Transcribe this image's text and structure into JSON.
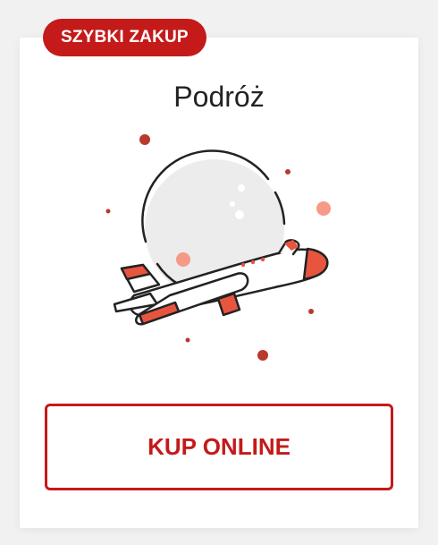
{
  "badge": {
    "label": "SZYBKI ZAKUP"
  },
  "card": {
    "title": "Podróż",
    "illustration_icon": "airplane-moon-icon"
  },
  "cta": {
    "label": "KUP ONLINE"
  },
  "colors": {
    "accent": "#c41a1a",
    "plane_accent": "#e8553f",
    "dot_light": "#f59a86",
    "dot_dark": "#b83a2c"
  }
}
